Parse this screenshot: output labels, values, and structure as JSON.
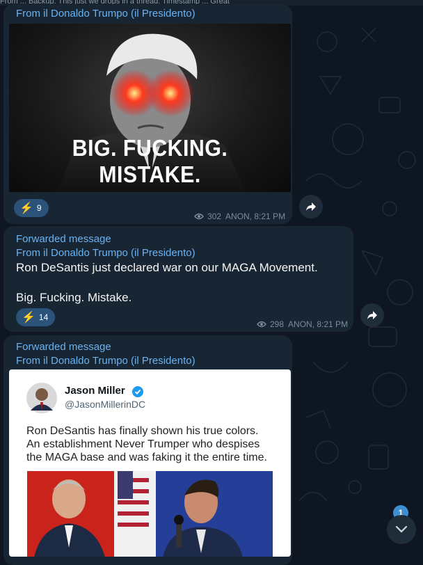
{
  "top_strip": "From ... Backup: This just we drops in a thread. Timestamp ... Great",
  "messages": [
    {
      "from": "From il Donaldo Trumpo (il Presidento)",
      "image_caption": "BIG. FUCKING. MISTAKE.",
      "reaction_count": "9",
      "views": "302",
      "author_time": "ANON, 8:21 PM"
    },
    {
      "forwarded": "Forwarded message",
      "from": "From il Donaldo Trumpo (il Presidento)",
      "text_line1": "Ron DeSantis just declared war on our MAGA Movement.",
      "text_line2": "Big. Fucking. Mistake.",
      "reaction_count": "14",
      "views": "298",
      "author_time": "ANON, 8:21 PM"
    },
    {
      "forwarded": "Forwarded message",
      "from": "From il Donaldo Trumpo (il Presidento)",
      "tweet": {
        "name": "Jason Miller",
        "handle": "@JasonMillerinDC",
        "line1": "Ron DeSantis has finally shown his true colors.",
        "line2": "An establishment Never Trumper who despises",
        "line3": "the MAGA base and was faking it the entire time."
      }
    }
  ],
  "unread_count": "1",
  "colors": {
    "background": "#0e1621",
    "bubble": "#182533",
    "link": "#6ab2f2",
    "reaction": "#2b5278",
    "verified": "#1d9bf0"
  },
  "icons": [
    "eye-icon",
    "share-arrow-icon",
    "lightning-icon",
    "verified-badge-icon",
    "chevron-down-icon"
  ]
}
